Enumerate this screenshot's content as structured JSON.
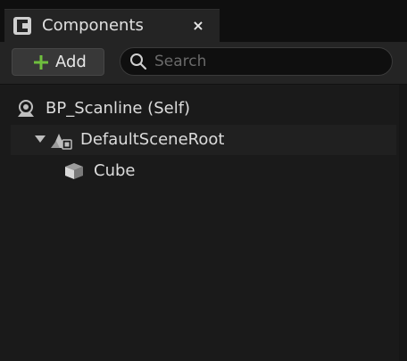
{
  "panel": {
    "tab_title": "Components",
    "close_glyph": "×"
  },
  "toolbar": {
    "add_label": "Add",
    "search_placeholder": "Search",
    "search_value": ""
  },
  "tree": {
    "items": [
      {
        "label": "BP_Scanline (Self)",
        "icon": "blueprint-self-icon",
        "depth": 0,
        "expanded": null
      },
      {
        "label": "DefaultSceneRoot",
        "icon": "scene-root-icon",
        "depth": 1,
        "expanded": true
      },
      {
        "label": "Cube",
        "icon": "cube-mesh-icon",
        "depth": 2,
        "expanded": null
      }
    ]
  },
  "colors": {
    "add_plus": "#6fbf3e",
    "background": "#1a1a1a",
    "toolbar": "#242424"
  }
}
